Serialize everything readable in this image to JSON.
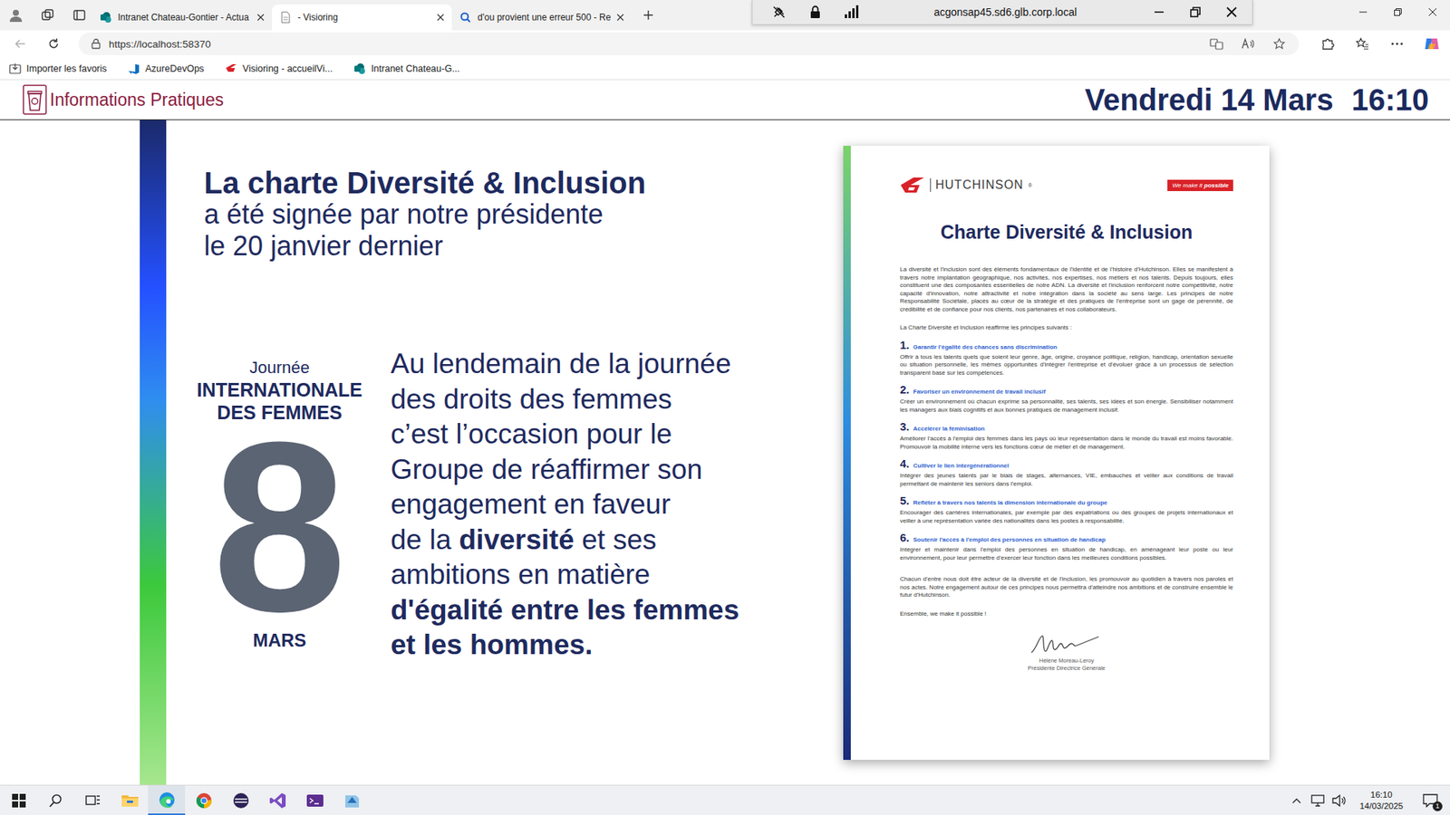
{
  "browser": {
    "tabs": [
      {
        "label": "Intranet Chateau-Gontier - Actua",
        "selected": false
      },
      {
        "label": "- Visioring",
        "selected": true
      },
      {
        "label": "d'ou provient une erreur 500 - Re",
        "selected": false
      }
    ],
    "remote_bar": {
      "title": "acgonsap45.sd6.glb.corp.local"
    },
    "address": "https://localhost:58370",
    "favorites": [
      "Importer les favoris",
      "AzureDevOps",
      "Visioring - accueilVi...",
      "Intranet Chateau-G..."
    ]
  },
  "page": {
    "header": {
      "title": "Informations Pratiques",
      "date": "Vendredi 14 Mars",
      "time": "16:10"
    },
    "slide": {
      "headline": "La charte Diversité & Inclusion",
      "sublines": [
        "a été signée par notre présidente",
        "le 20 janvier dernier"
      ],
      "journee": {
        "top": "Journée",
        "title_lines": [
          "INTERNATIONALE",
          "DES FEMMES"
        ],
        "number": "8",
        "month": "MARS"
      },
      "paragraph": [
        [
          {
            "text": "Au lendemain de la journée",
            "bold": false
          }
        ],
        [
          {
            "text": "des droits des femmes",
            "bold": false
          }
        ],
        [
          {
            "text": "c’est l’occasion pour le",
            "bold": false
          }
        ],
        [
          {
            "text": "Groupe de réaffirmer son",
            "bold": false
          }
        ],
        [
          {
            "text": "engagement en faveur",
            "bold": false
          }
        ],
        [
          {
            "text": "de la ",
            "bold": false
          },
          {
            "text": "diversité",
            "bold": true
          },
          {
            "text": " et ses",
            "bold": false
          }
        ],
        [
          {
            "text": "ambitions en matière",
            "bold": false
          }
        ],
        [
          {
            "text": "d'égalité entre les femmes",
            "bold": true
          }
        ],
        [
          {
            "text": "et les hommes.",
            "bold": true
          }
        ]
      ]
    },
    "document": {
      "brand": "HUTCHINSON",
      "brand_mark": "®",
      "slogan_lead": "We make it ",
      "slogan_accent": "possible",
      "title": "Charte Diversité & Inclusion",
      "intro": "La diversité et l'inclusion sont des éléments fondamentaux de l'identité et de l'histoire d'Hutchinson. Elles se manifestent à travers notre implantation géographique, nos activités, nos expertises, nos métiers et nos talents. Depuis toujours, elles constituent une des composantes essentielles de notre ADN. La diversité et l'inclusion renforcent notre compétitivité, notre capacité d'innovation, notre attractivité et notre intégration dans la société au sens large. Les principes de notre Responsabilité Sociétale, placés au cœur de la stratégie et des pratiques de l'entreprise sont un gage de pérennité, de crédibilité et de confiance pour nos clients, nos partenaires et nos collaborateurs.",
      "principles_lead": "La Charte Diversité et Inclusion réaffirme les principes suivants :",
      "principles": [
        {
          "number": "1.",
          "title": "Garantir l'égalité des chances sans discrimination",
          "text": "Offrir à tous les talents quels que soient leur genre, âge, origine, croyance politique, religion, handicap, orientation sexuelle ou situation personnelle, les mêmes opportunités d'intégrer l'entreprise et d'évoluer grâce à un processus de sélection transparent basé sur les compétences."
        },
        {
          "number": "2.",
          "title": "Favoriser un environnement de travail inclusif",
          "text": "Créer un environnement où chacun exprime sa personnalité, ses talents, ses idées et son énergie. Sensibiliser notamment les managers aux biais cognitifs et aux bonnes pratiques de management inclusif."
        },
        {
          "number": "3.",
          "title": "Accélérer la féminisation",
          "text": "Améliorer l'accès à l'emploi des femmes dans les pays où leur représentation dans le monde du travail est moins favorable. Promouvoir la mobilité interne vers les fonctions cœur de métier et de management."
        },
        {
          "number": "4.",
          "title": "Cultiver le lien intergénérationnel",
          "text": "Intégrer des jeunes talents par le biais de stages, alternances, VIE, embauches et veiller aux conditions de travail permettant de maintenir les seniors dans l'emploi."
        },
        {
          "number": "5.",
          "title": "Refléter à travers nos talents la dimension internationale du groupe",
          "text": "Encourager des carrières internationales, par exemple par des expatriations ou des groupes de projets internationaux et veiller à une représentation variée des nationalités dans les postes à responsabilité."
        },
        {
          "number": "6.",
          "title": "Soutenir l'accès à l'emploi des personnes en situation de handicap",
          "text": "Intégrer et maintenir dans l'emploi des personnes en situation de handicap, en aménageant leur poste ou leur environnement, pour leur permettre d'exercer leur fonction dans les meilleures conditions possibles."
        }
      ],
      "closing": "Chacun d'entre nous doit être acteur de la diversité et de l'inclusion, les promouvoir au quotidien à travers nos paroles et nos actes. Notre engagement autour de ces principes nous permettra d'atteindre nos ambitions et de construire ensemble le futur d'Hutchinson.",
      "signoff": "Ensemble, we make it possible !",
      "signer": "Hélène Moreau-Leroy",
      "signer_role": "Présidente Directrice Générale"
    }
  },
  "taskbar": {
    "time": "16:10",
    "date": "14/03/2025",
    "notifications": "1"
  }
}
